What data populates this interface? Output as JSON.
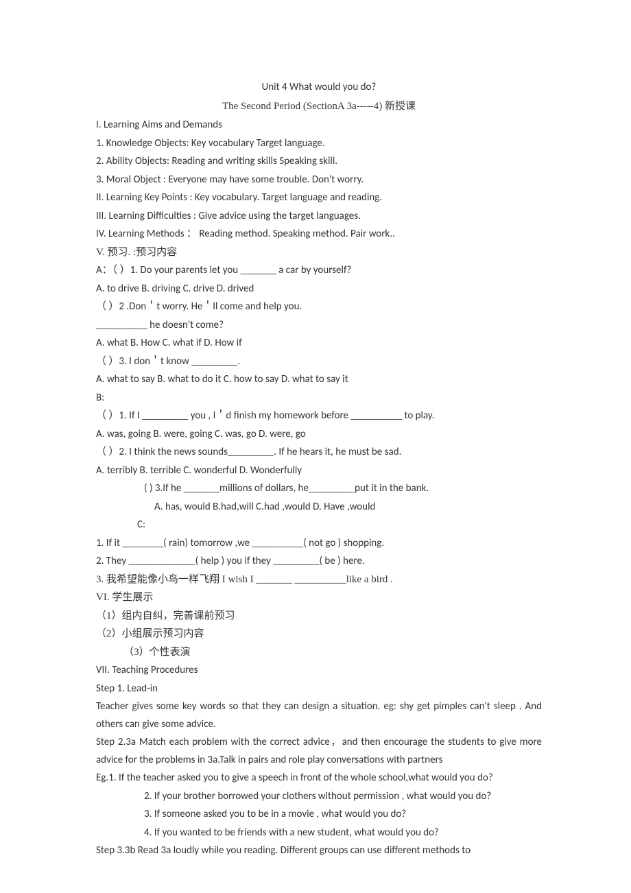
{
  "title": {
    "main": "Unit 4    What would you do?",
    "sub": "The Second Period (SectionA 3a-----4)  新授课"
  },
  "sections": {
    "i_heading": "I. Learning Aims and Demands",
    "i1": "1. Knowledge Objects:      Key vocabulary               Target language.",
    "i2": "2. Ability Objects:        Reading and writing skills          Speaking skill.",
    "i3": "3. Moral Object :         Everyone may have some trouble. Don't worry.",
    "ii": "II. Learning Key Points :    Key vocabulary.        Target language and reading.",
    "iii": "III. Learning Difficulties :    Give advice using the target languages.",
    "iv": "IV. Learning Methods  ：    Reading method.      Speaking method.      Pair work..",
    "v_heading": "V.  预习.   :预习内容",
    "a1": "A：（    ）1. Do your parents let you _______ a car by yourself?",
    "a1_opts": "A. to drive          B. driving           C. drive           D. drived",
    "a2": "（    ）2 .Don＇t worry. He＇ll come and help you.",
    "a2b": "__________ he doesn't come?",
    "a2_opts": "A. what             B. How               C. what if           D. How if",
    "a3": "（    ）3. I don＇t know _________.",
    "a3_opts": "A. what to say        B. what to do it      C. how to say      D. what to say it",
    "b_heading": "B:",
    "b1": "（      ）1. If I _________ you , I＇d finish my homework before __________ to play.",
    "b1_opts": "A. was, going        B. were, going         C. was, go         D. were, go",
    "b2": "（    ）2. I think the news sounds_________. If he hears it, he must be sad.",
    "b2_opts": "A. terribly           B. terrible             C. wonderful       D. Wonderfully",
    "b3": "(      ) 3.If he _______millions of dollars, he_________put it in the bank.",
    "b3_opts": "A. has, would        B.had,will          C.had ,would       D. Have ,would",
    "c_heading": "C:",
    "c1": "1.      If it ________( rain) tomorrow ,we __________( not go ) shopping.",
    "c2": "2.      They _____________( help ) you if they _________( be ) here.",
    "c3": "3.      我希望能像小鸟一样飞翔 I wish I _______ __________like a bird .",
    "vi_heading": "VI.  学生展示",
    "vi1": "（1）组内自纠，完善课前预习",
    "vi2": "（2）小组展示预习内容",
    "vi3": "（3）个性表演",
    "vii_heading": "VII. Teaching    Procedures",
    "step1_heading": "Step 1. Lead-in",
    "step1_body": "               Teacher gives some key words so that they can design a situation. eg: shy    get pimples    can't sleep . And others can give some advice.",
    "step2": "Step 2.3a       Match each problem with the correct advice，and then encourage the students to give more advice for the problems in 3a.Talk in pairs and role play conversations with partners",
    "step2_eg1": "          Eg.1. If the teacher asked you to give a speech in front of the whole school,what would you do?",
    "step2_eg2": "2. If your brother borrowed your clothers without permission , what would you do?",
    "step2_eg3": "3. If someone asked you to be in a movie , what would you do?",
    "step2_eg4": "4. If you wanted to be friends with a new student, what would you do?",
    "step3": "Step 3.3b        Read 3a loudly while you reading. Different groups can use different methods to"
  }
}
